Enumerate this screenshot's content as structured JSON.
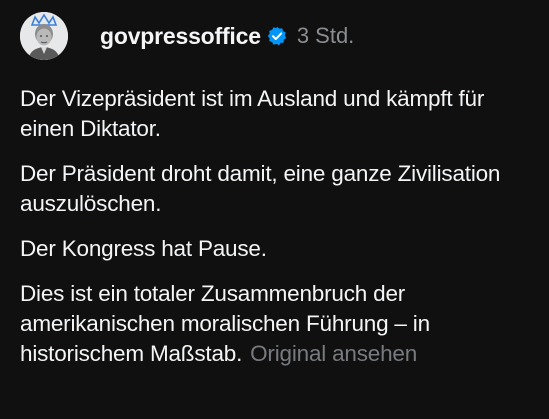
{
  "post": {
    "username": "govpressoffice",
    "timestamp": "3 Std.",
    "paragraphs": [
      "Der Vizepräsident ist im Ausland und kämpft für einen Diktator.",
      "Der Präsident droht damit, eine ganze Zivilisation auszulöschen.",
      "Der Kongress hat Pause.",
      "Dies ist ein totaler Zusammenbruch der amerikanischen moralischen Führung – in historischem Maßstab."
    ],
    "translate_label": "Original ansehen"
  },
  "icons": {
    "avatar": "avatar-portrait-with-crown",
    "verified": "verified-badge-icon"
  },
  "colors": {
    "background": "#101010",
    "text": "#f3f5f7",
    "muted": "#8a8d91",
    "verified": "#0095f6"
  }
}
